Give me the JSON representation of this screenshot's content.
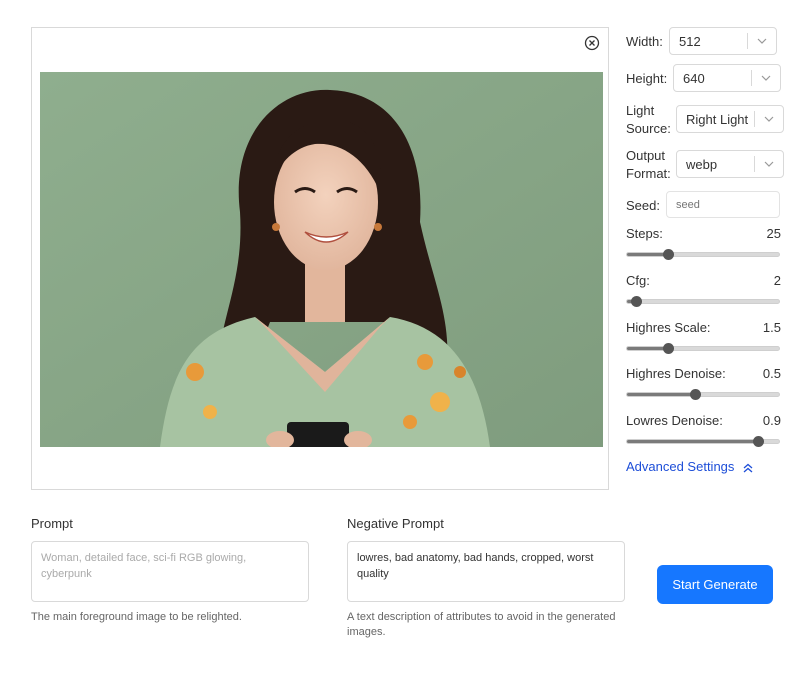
{
  "image_panel": {
    "close_icon": "circle-x-icon"
  },
  "settings": {
    "width": {
      "label": "Width:",
      "value": "512"
    },
    "height": {
      "label": "Height:",
      "value": "640"
    },
    "light_source": {
      "label_line1": "Light",
      "label_line2": "Source:",
      "value": "Right Light"
    },
    "output_format": {
      "label_line1": "Output",
      "label_line2": "Format:",
      "value": "webp"
    },
    "seed": {
      "label": "Seed:",
      "placeholder": "seed"
    },
    "sliders": [
      {
        "label": "Steps:",
        "value": "25",
        "fraction": 0.27
      },
      {
        "label": "Cfg:",
        "value": "2",
        "fraction": 0.06
      },
      {
        "label": "Highres Scale:",
        "value": "1.5",
        "fraction": 0.27
      },
      {
        "label": "Highres Denoise:",
        "value": "0.5",
        "fraction": 0.45
      },
      {
        "label": "Lowres Denoise:",
        "value": "0.9",
        "fraction": 0.86
      }
    ],
    "advanced_label": "Advanced Settings"
  },
  "prompt": {
    "title": "Prompt",
    "placeholder": "Woman, detailed face, sci-fi RGB glowing, cyberpunk",
    "help": "The main foreground image to be relighted."
  },
  "negative_prompt": {
    "title": "Negative Prompt",
    "value": "lowres, bad anatomy, bad hands, cropped, worst quality",
    "help": "A text description of attributes to avoid in the generated images."
  },
  "generate_button": "Start Generate",
  "colors": {
    "accent": "#1677ff",
    "link": "#1d4ed8",
    "photo_background": "#8da98c"
  }
}
